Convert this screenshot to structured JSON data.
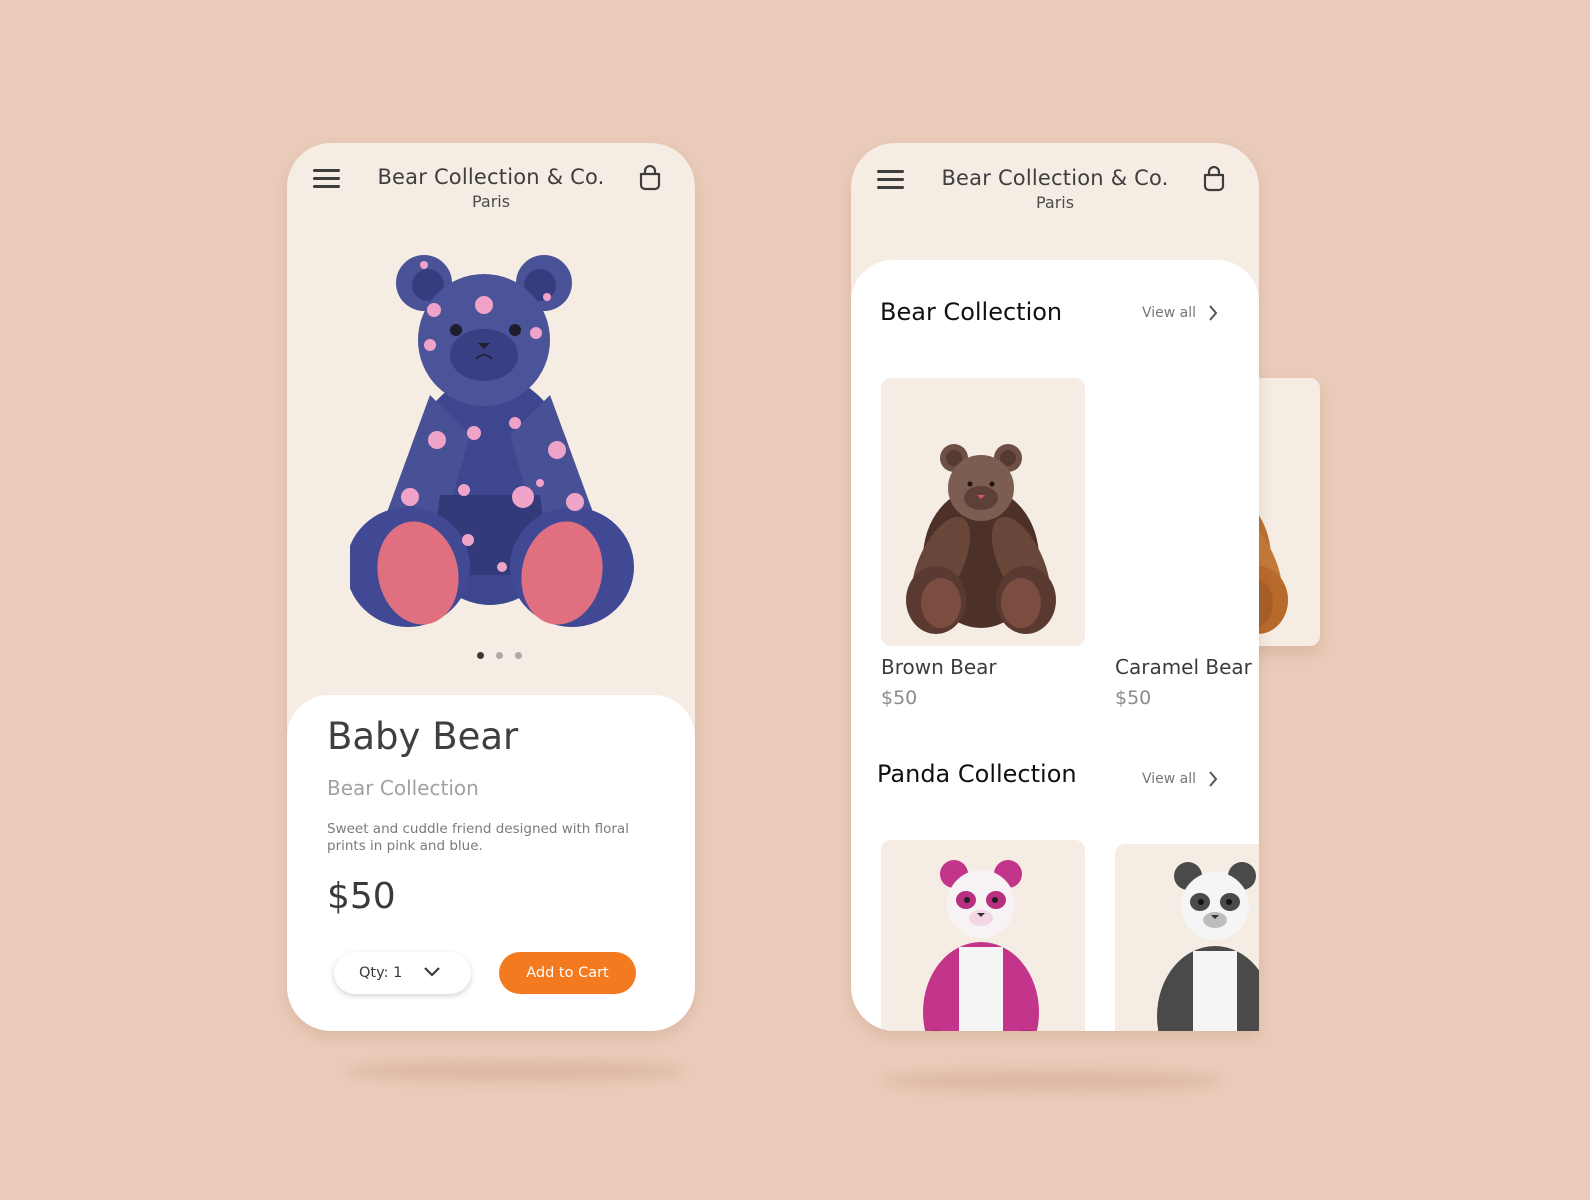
{
  "left_screen": {
    "brand_title": "Bear Collection & Co.",
    "brand_city": "Paris",
    "carousel": {
      "slides": 3,
      "active": 1
    },
    "product": {
      "name": "Baby Bear",
      "collection": "Bear Collection",
      "description": "Sweet and cuddle friend designed with floral prints in pink and blue.",
      "price": "$50",
      "qty_label": "Qty: 1",
      "add_to_cart": "Add to Cart"
    }
  },
  "right_screen": {
    "brand_title": "Bear Collection & Co.",
    "brand_city": "Paris",
    "sections": [
      {
        "title": "Bear Collection",
        "view_all": "View all",
        "items": [
          {
            "name": "Brown Bear",
            "price": "$50"
          },
          {
            "name": "Caramel Bear",
            "price": "$50"
          }
        ]
      },
      {
        "title": "Panda Collection",
        "view_all": "View all",
        "items": []
      }
    ]
  },
  "colors": {
    "accent": "#f47a1f",
    "background": "#eacbb9",
    "card": "#f5ece4"
  },
  "icons": [
    "menu-icon",
    "shopping-bag-icon",
    "chevron-down-icon",
    "chevron-right-icon"
  ]
}
